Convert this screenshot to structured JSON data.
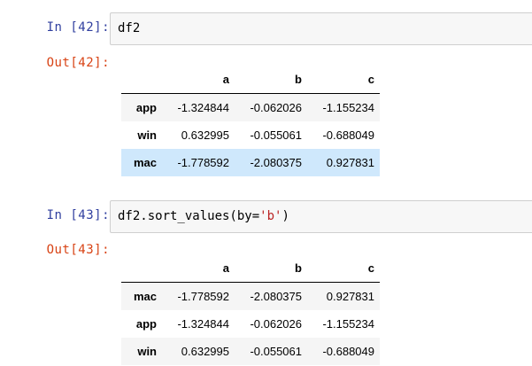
{
  "cells": [
    {
      "in_prompt": "In  [42]:",
      "code": "df2",
      "out_prompt": "Out[42]:",
      "columns": [
        "a",
        "b",
        "c"
      ],
      "rows": [
        {
          "index": "app",
          "values": [
            "-1.324844",
            "-0.062026",
            "-1.155234"
          ]
        },
        {
          "index": "win",
          "values": [
            "0.632995",
            "-0.055061",
            "-0.688049"
          ]
        },
        {
          "index": "mac",
          "values": [
            "-1.778592",
            "-2.080375",
            "0.927831"
          ]
        }
      ]
    },
    {
      "in_prompt": "In  [43]:",
      "code_prefix": "df2.sort_values(by=",
      "code_string": "'b'",
      "code_suffix": ")",
      "out_prompt": "Out[43]:",
      "columns": [
        "a",
        "b",
        "c"
      ],
      "rows": [
        {
          "index": "mac",
          "values": [
            "-1.778592",
            "-2.080375",
            "0.927831"
          ]
        },
        {
          "index": "app",
          "values": [
            "-1.324844",
            "-0.062026",
            "-1.155234"
          ]
        },
        {
          "index": "win",
          "values": [
            "0.632995",
            "-0.055061",
            "-0.688049"
          ]
        }
      ]
    }
  ],
  "colors": {
    "in_prompt": "#303f9f",
    "out_prompt": "#d84315",
    "input_bg": "#f7f7f7",
    "row_highlight": "#cfe8fc",
    "row_stripe": "#f5f5f5"
  }
}
